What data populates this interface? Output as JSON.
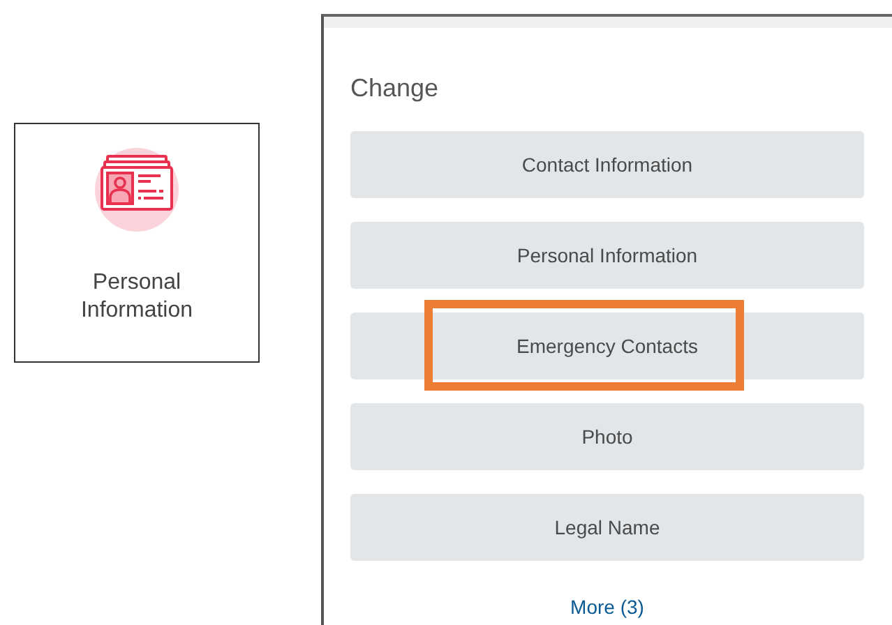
{
  "tile": {
    "label": "Personal Information"
  },
  "panel": {
    "title": "Change",
    "items": [
      {
        "label": "Contact Information",
        "highlighted": false
      },
      {
        "label": "Personal Information",
        "highlighted": false
      },
      {
        "label": "Emergency Contacts",
        "highlighted": true
      },
      {
        "label": "Photo",
        "highlighted": false
      },
      {
        "label": "Legal Name",
        "highlighted": false
      }
    ],
    "more_link": "More (3)"
  }
}
